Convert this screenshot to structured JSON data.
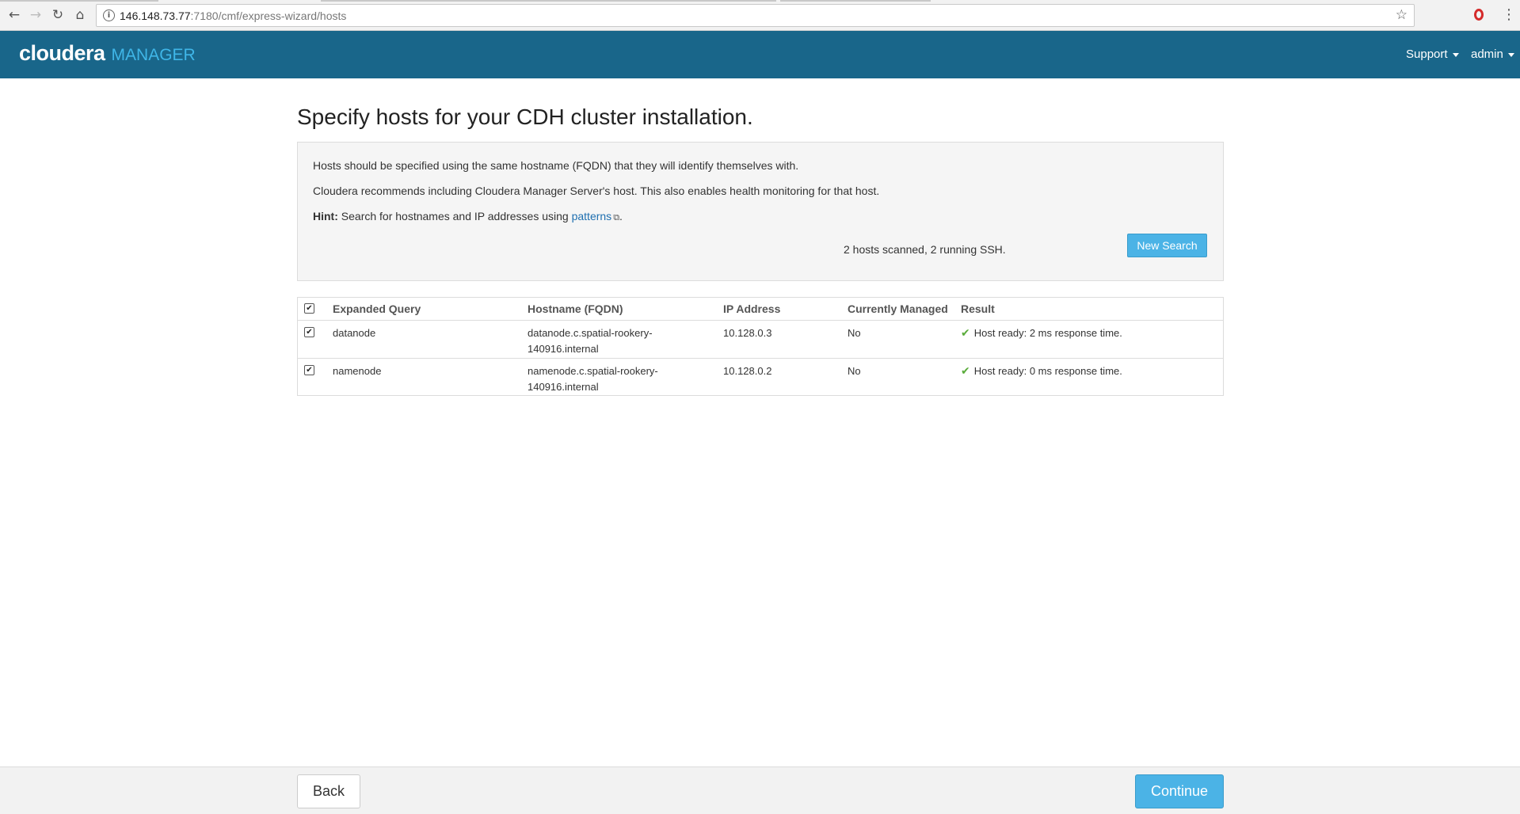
{
  "browser": {
    "url_host": "146.148.73.77",
    "url_path": ":7180/cmf/express-wizard/hosts",
    "back_icon": "back-arrow-icon",
    "forward_icon": "forward-arrow-icon",
    "reload_icon": "reload-icon",
    "home_icon": "home-icon"
  },
  "header": {
    "brand": "cloudera",
    "product": "MANAGER",
    "support_label": "Support",
    "user_label": "admin",
    "bg_color": "#19668a"
  },
  "page": {
    "title": "Specify hosts for your CDH cluster installation."
  },
  "info": {
    "line1": "Hosts should be specified using the same hostname (FQDN) that they will identify themselves with.",
    "line2": "Cloudera recommends including Cloudera Manager Server's host. This also enables health monitoring for that host.",
    "hint_label": "Hint:",
    "hint_text": "Search for hostnames and IP addresses using",
    "hint_link": "patterns",
    "hint_end": ".",
    "scan_status": "2 hosts scanned, 2 running SSH.",
    "new_search_label": "New Search"
  },
  "table": {
    "columns": [
      "Expanded Query",
      "Hostname (FQDN)",
      "IP Address",
      "Currently Managed",
      "Result"
    ],
    "select_all_checked": true,
    "rows": [
      {
        "checked": true,
        "query": "datanode",
        "hostname": "datanode.c.spatial-rookery-140916.internal",
        "ip": "10.128.0.3",
        "managed": "No",
        "result": "Host ready: 2 ms response time."
      },
      {
        "checked": true,
        "query": "namenode",
        "hostname": "namenode.c.spatial-rookery-140916.internal",
        "ip": "10.128.0.2",
        "managed": "No",
        "result": "Host ready: 0 ms response time."
      }
    ]
  },
  "footer": {
    "back_label": "Back",
    "continue_label": "Continue"
  },
  "colors": {
    "accent": "#4bb3e6",
    "success": "#5aac3b",
    "link": "#1e6fb0"
  }
}
